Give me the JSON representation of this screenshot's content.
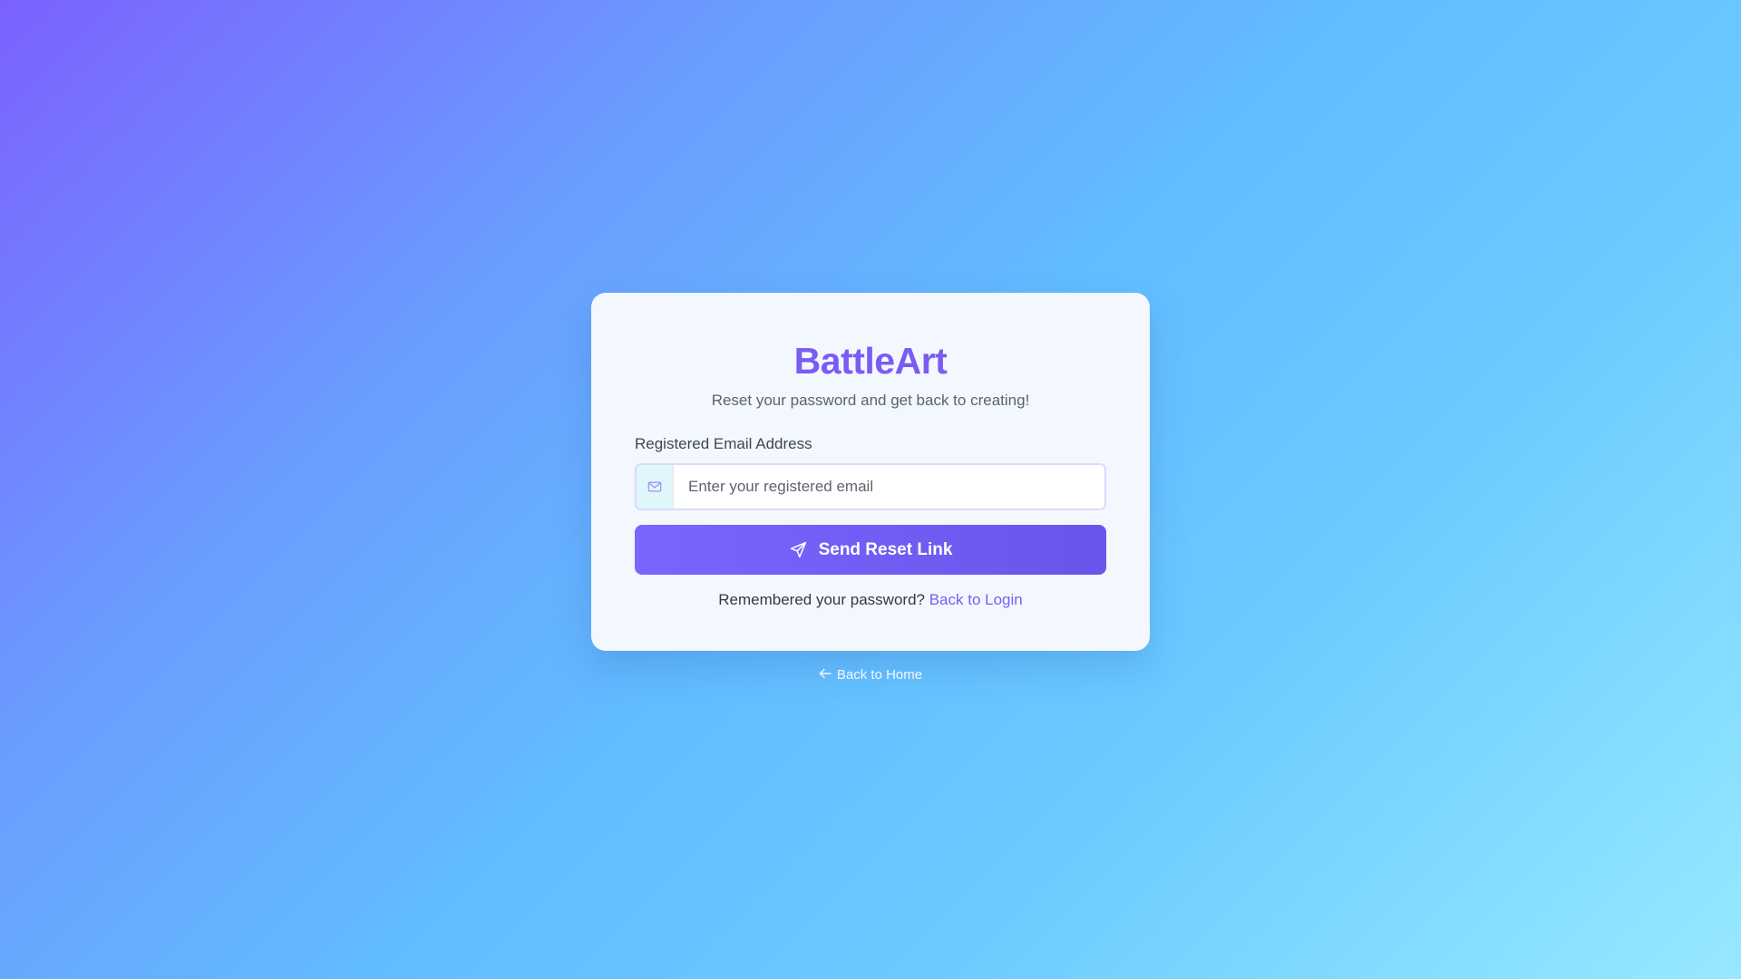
{
  "brand": {
    "name": "BattleArt",
    "tagline": "Reset your password and get back to creating!"
  },
  "form": {
    "email_label": "Registered Email Address",
    "email_placeholder": "Enter your registered email",
    "email_value": "",
    "email_icon": "envelope-icon",
    "submit_label": "Send Reset Link",
    "submit_icon": "send-icon"
  },
  "login_prompt": {
    "text": "Remembered your password?",
    "link_label": "Back to Login"
  },
  "home_link": {
    "icon": "arrow-left-icon",
    "label": "Back to Home"
  },
  "colors": {
    "brand": "#7b5cf3",
    "button": "#6f5cf6",
    "background_start": "#7b61ff",
    "background_end": "#97e9ff"
  }
}
